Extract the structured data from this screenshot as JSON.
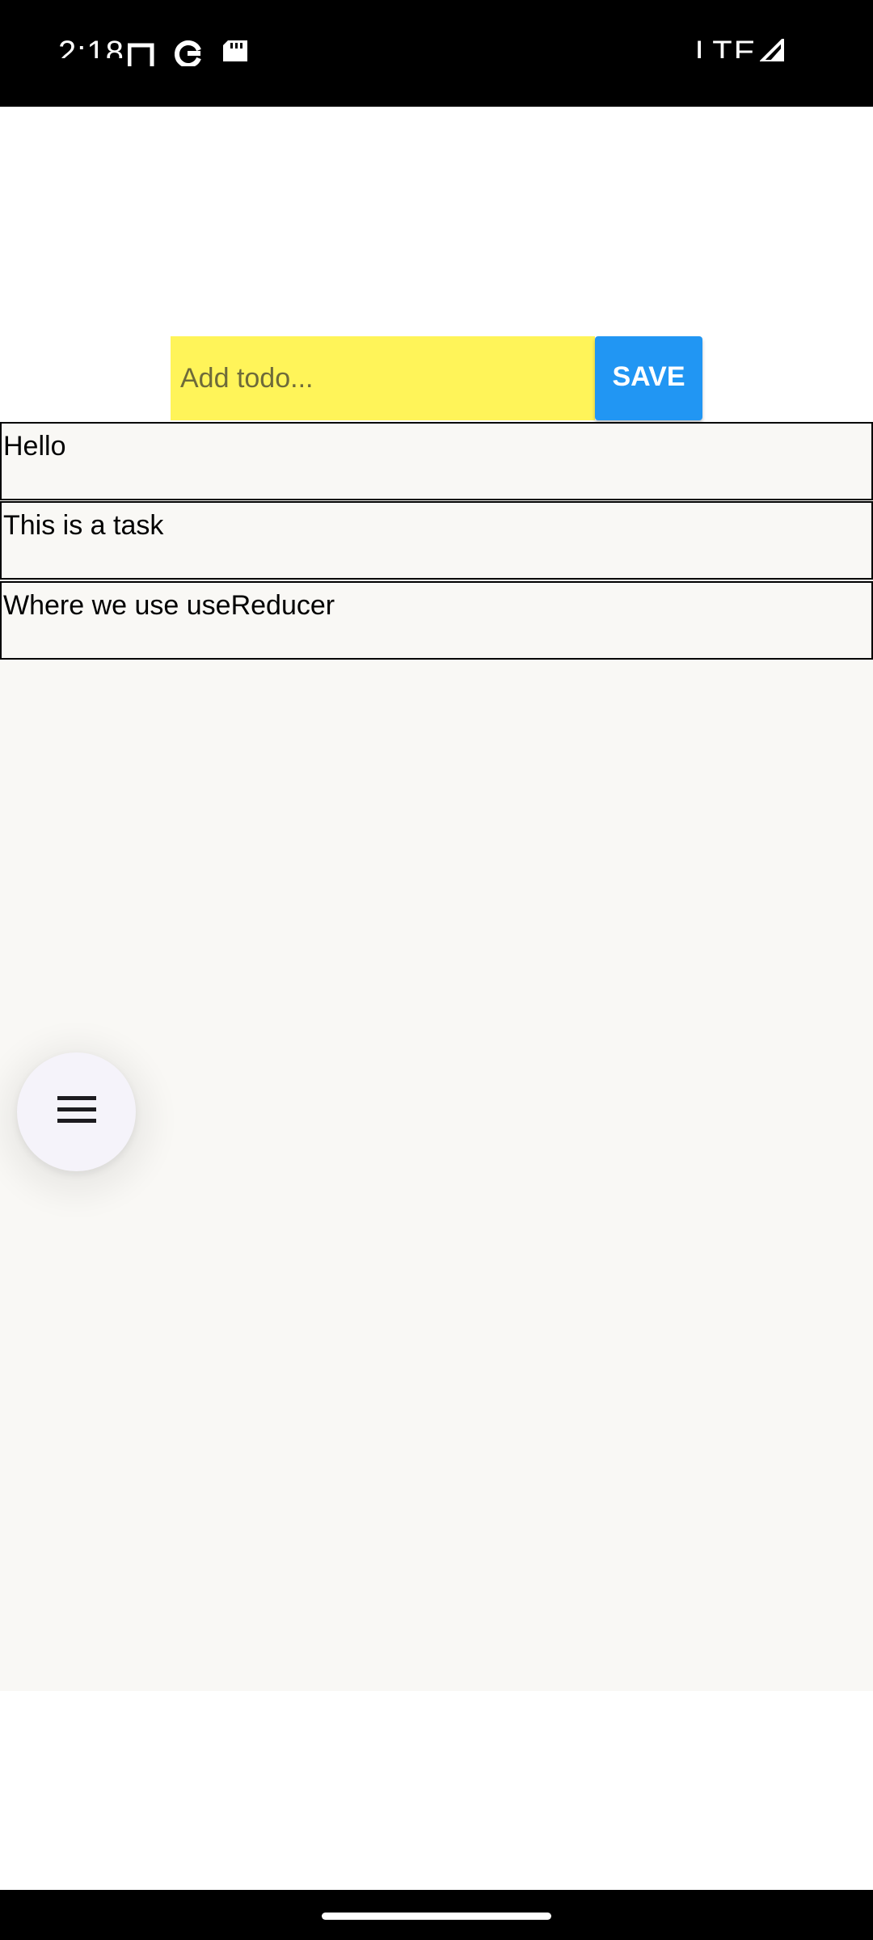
{
  "status_bar": {
    "time": "2:18",
    "network": "LTE",
    "icons": [
      "screen-record-icon",
      "google-icon",
      "sd-card-icon",
      "signal-icon"
    ]
  },
  "todo_input": {
    "placeholder": "Add todo...",
    "value": "",
    "background": "#fff459"
  },
  "save_button": {
    "label": "SAVE",
    "color": "#2196f3"
  },
  "todos": [
    {
      "text": "Hello"
    },
    {
      "text": "This is a task"
    },
    {
      "text": "Where we use useReducer"
    }
  ],
  "fab": {
    "icon": "menu-icon"
  }
}
